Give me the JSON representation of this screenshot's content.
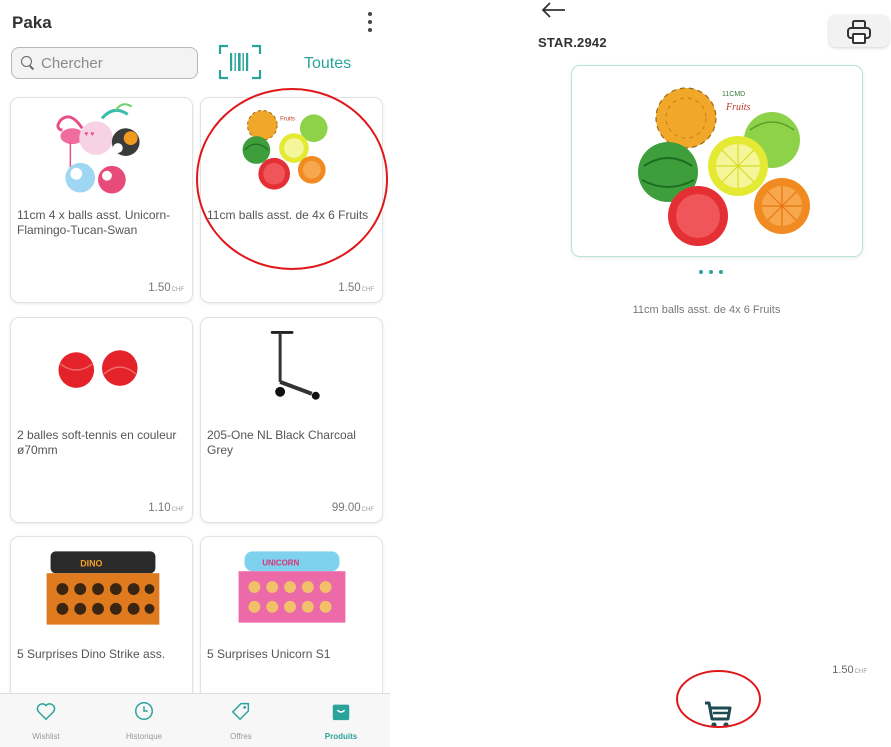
{
  "app": {
    "title": "Paka"
  },
  "search": {
    "placeholder": "Chercher"
  },
  "filter": {
    "label": "Toutes"
  },
  "products": [
    {
      "name": "11cm 4 x balls asst. Unicorn-Flamingo-Tucan-Swan",
      "price": "1.50",
      "currency": "CHF"
    },
    {
      "name": "11cm balls asst. de 4x 6 Fruits",
      "price": "1.50",
      "currency": "CHF"
    },
    {
      "name": "2 balles soft-tennis en couleur ø70mm",
      "price": "1.10",
      "currency": "CHF"
    },
    {
      "name": "205-One NL Black Charcoal Grey",
      "price": "99.00",
      "currency": "CHF"
    },
    {
      "name": "5 Surprises Dino Strike ass.",
      "price": "",
      "currency": ""
    },
    {
      "name": "5 Surprises Unicorn S1",
      "price": "",
      "currency": ""
    }
  ],
  "nav": [
    {
      "label": "Wishlist",
      "icon": "heart-icon"
    },
    {
      "label": "Historique",
      "icon": "history-icon"
    },
    {
      "label": "Offres",
      "icon": "tag-icon"
    },
    {
      "label": "Produits",
      "icon": "bag-icon",
      "active": true
    }
  ],
  "detail": {
    "sku": "STAR.2942",
    "description": "11cm balls asst. de 4x 6 Fruits",
    "price": "1.50",
    "currency": "CHF",
    "image_count": 3
  },
  "colors": {
    "accent": "#2aa39a",
    "highlight": "#e0171a"
  }
}
